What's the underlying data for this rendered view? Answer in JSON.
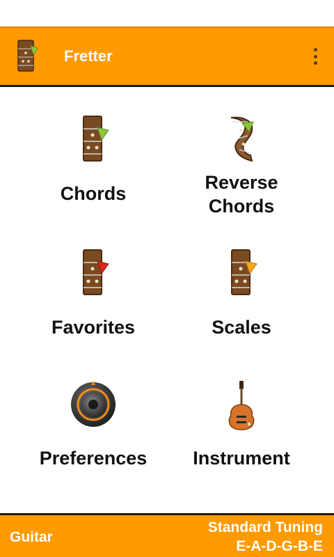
{
  "app_bar": {
    "title": "Fretter",
    "logo_icon": "fretboard-pick-icon",
    "menu_icon": "overflow-menu-icon"
  },
  "menu": [
    {
      "label": "Chords",
      "icon": "fretboard-green-pick-icon"
    },
    {
      "label": "Reverse Chords",
      "icon": "twisted-fretboard-icon"
    },
    {
      "label": "Favorites",
      "icon": "fretboard-red-pick-icon"
    },
    {
      "label": "Scales",
      "icon": "fretboard-orange-pick-icon"
    },
    {
      "label": "Preferences",
      "icon": "dial-knob-icon"
    },
    {
      "label": "Instrument",
      "icon": "electric-guitar-icon"
    }
  ],
  "bottom_bar": {
    "instrument": "Guitar",
    "tuning_name": "Standard Tuning",
    "tuning_notes": "E-A-D-G-B-E"
  },
  "colors": {
    "accent": "#ff9a00",
    "fret_wood": "#7a4a22",
    "pick_green": "#8cc63f",
    "pick_red": "#d9261c",
    "pick_orange": "#f5a623"
  }
}
